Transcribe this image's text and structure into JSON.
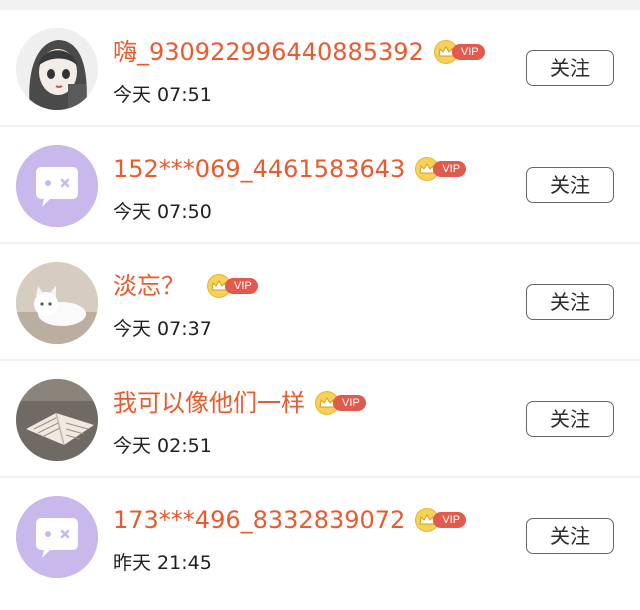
{
  "users": [
    {
      "name": "嗨_9309229964408853​92",
      "time": "今天 07:51",
      "avatar": "anime-girl",
      "badge": "VIP",
      "follow_label": "关注"
    },
    {
      "name": "152***069_4461583643",
      "time": "今天 07:50",
      "avatar": "default-chat",
      "badge": "VIP",
      "follow_label": "关注"
    },
    {
      "name": "淡忘？",
      "time": "今天 07:37",
      "avatar": "kitten",
      "badge": "VIP",
      "follow_label": "关注"
    },
    {
      "name": "我可以像他们一样",
      "time": "今天 02:51",
      "avatar": "book",
      "badge": "VIP",
      "follow_label": "关注"
    },
    {
      "name": "173***496_8332839072",
      "time": "昨天 21:45",
      "avatar": "default-chat",
      "badge": "VIP",
      "follow_label": "关注"
    }
  ],
  "colors": {
    "name": "#e95a2f",
    "vip": "#e25a4d",
    "crown": "#f6d25a",
    "default_avatar": "#c9b8ec"
  }
}
